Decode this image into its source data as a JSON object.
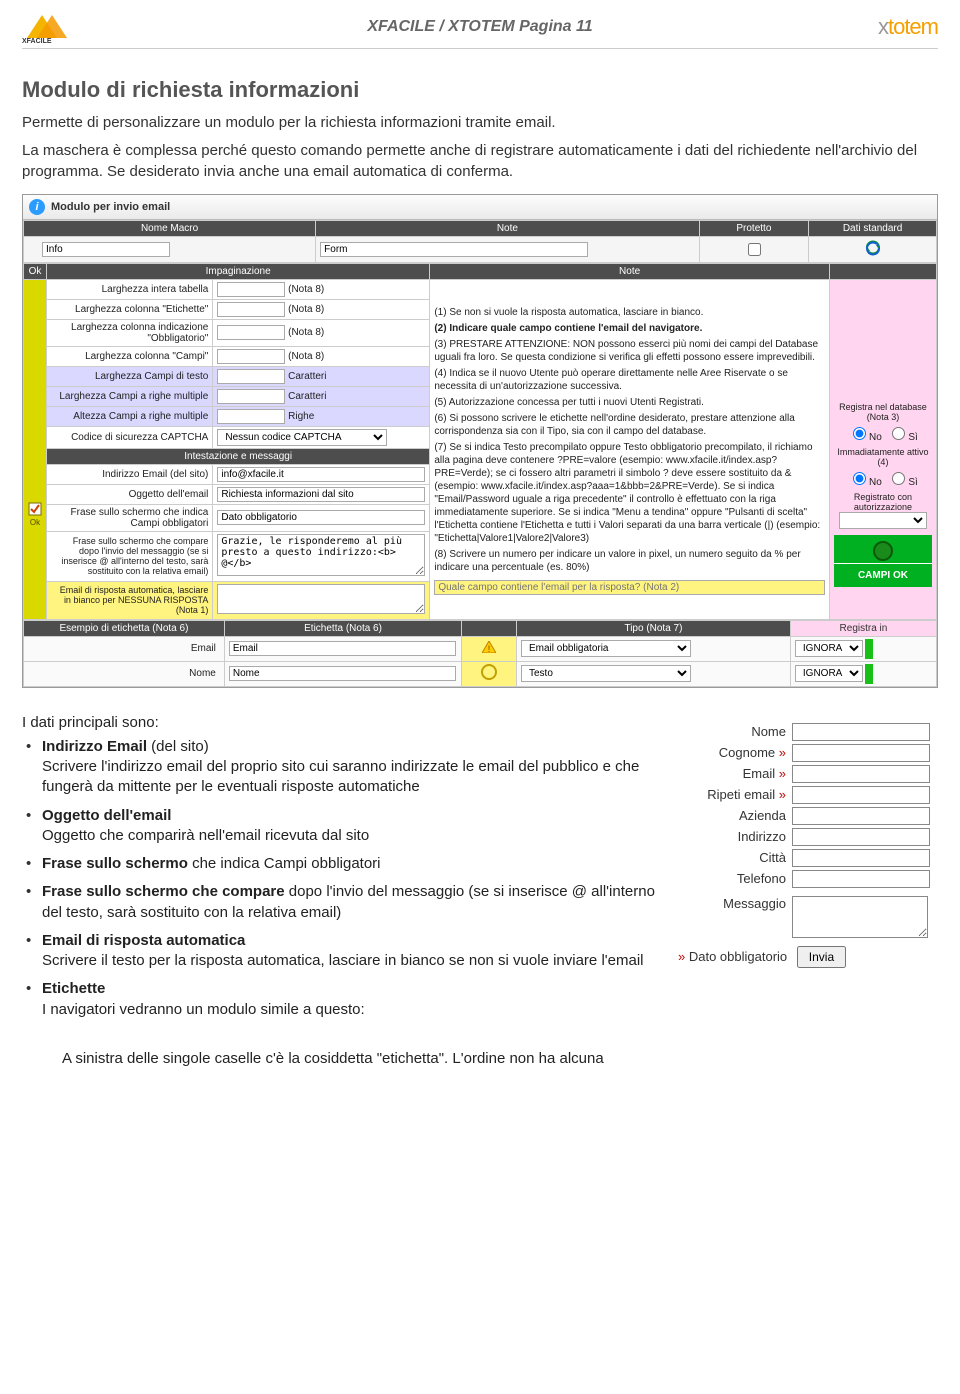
{
  "header": {
    "title": "XFACILE / XTOTEM Pagina 11",
    "brand_left": "xfacile",
    "brand_right": "xtotem"
  },
  "section": {
    "heading": "Modulo di richiesta informazioni",
    "intro1": "Permette di personalizzare un modulo per la richiesta informazioni tramite email.",
    "intro2": "La maschera è complessa perché questo comando permette anche di registrare automaticamente i dati del richiedente nell'archivio del programma. Se desiderato invia anche una email automatica di conferma."
  },
  "ui": {
    "titlebar": "Modulo per invio email",
    "head": {
      "c1": "Nome Macro",
      "c2": "Note",
      "c3": "Protetto",
      "c4": "Dati standard"
    },
    "macrorow": {
      "name": "Info",
      "note": "Form"
    },
    "sub_head": {
      "ok": "Ok",
      "imp": "Impaginazione",
      "note": "Note"
    },
    "rows": [
      {
        "label": "Larghezza intera tabella",
        "val": "(Nota 8)"
      },
      {
        "label": "Larghezza colonna \"Etichette\"",
        "val": "(Nota 8)"
      },
      {
        "label": "Larghezza colonna indicazione \"Obbligatorio\"",
        "val": "(Nota 8)"
      },
      {
        "label": "Larghezza colonna \"Campi\"",
        "val": "(Nota 8)"
      },
      {
        "label": "Larghezza Campi di testo",
        "val": "Caratteri",
        "hl": true
      },
      {
        "label": "Larghezza Campi a righe multiple",
        "val": "Caratteri",
        "hl": true
      },
      {
        "label": "Altezza Campi a righe multiple",
        "val": "Righe",
        "hl": true
      },
      {
        "label": "Codice di sicurezza CAPTCHA",
        "val": "Nessun codice CAPTCHA",
        "select": true
      },
      {
        "label": "Intestazione e messaggi",
        "span": true,
        "dark": true
      },
      {
        "label": "Indirizzo Email (del sito)",
        "val": "info@xfacile.it"
      },
      {
        "label": "Oggetto dell'email",
        "val": "Richiesta informazioni dal sito"
      },
      {
        "label": "Frase sullo schermo che indica Campi obbligatori",
        "val": "Dato obbligatorio"
      },
      {
        "label": "Frase sullo schermo che compare dopo l'invio del messaggio (se si inserisce @ all'interno del testo, sarà sostituito con la relativa email)",
        "val": "Grazie, le risponderemo al più presto a questo indirizzo:<b> @</b>"
      },
      {
        "label": "Email di risposta automatica, lasciare in bianco per NESSUNA RISPOSTA (Nota 1)",
        "val": "",
        "yellow": true
      }
    ],
    "notes": [
      "(1) Se non si vuole la risposta automatica, lasciare in bianco.",
      "(2) Indicare quale campo contiene l'email del navigatore.",
      "(3) PRESTARE ATTENZIONE: NON possono esserci più nomi dei campi del Database uguali fra loro. Se questa condizione si verifica gli effetti possono essere imprevedibili.",
      "(4) Indica se il nuovo Utente può operare direttamente nelle Aree Riservate o se necessita di un'autorizzazione successiva.",
      "(5) Autorizzazione concessa per tutti i nuovi Utenti Registrati.",
      "(6) Si possono scrivere le etichette nell'ordine desiderato, prestare attenzione alla corrispondenza sia con il Tipo, sia con il campo del database.",
      "(7) Se si indica Testo precompilato oppure Testo obbligatorio precompilato, il richiamo alla pagina deve contenere ?PRE=valore (esempio: www.xfacile.it/index.asp?PRE=Verde); se ci fossero altri parametri il simbolo ? deve essere sostituito da & (esempio: www.xfacile.it/index.asp?aaa=1&bbb=2&PRE=Verde). Se si indica \"Email/Password uguale a riga precedente\" il controllo è effettuato con la riga immediatamente superiore. Se si indica \"Menu a tendina\" oppure \"Pulsanti di scelta\" l'Etichetta contiene l'Etichetta e tutti i Valori separati da una barra verticale (|) (esempio: \"Etichetta|Valore1|Valore2|Valore3)",
      "(8) Scrivere un numero per indicare un valore in pixel, un numero seguito da % per indicare una percentuale (es. 80%)"
    ],
    "note2_placeholder": "Quale campo contiene l'email per la risposta? (Nota 2)",
    "pink": {
      "registra_label": "Registra nel database (Nota 3)",
      "no": "No",
      "si": "Sì",
      "imm_label": "Immadiatamente attivo (4)",
      "reg_auth": "Registrato con autorizzazione",
      "campi_ok": "CAMPI OK",
      "registra_in": "Registra in",
      "ignora": "IGNORA"
    },
    "fields_head": {
      "esempio": "Esempio di etichetta (Nota 6)",
      "et": "Etichetta (Nota 6)",
      "tipo": "Tipo (Nota 7)"
    },
    "fields": [
      {
        "name": "Email",
        "et": "Email",
        "tipo": "Email obbligatoria",
        "warn": true
      },
      {
        "name": "Nome",
        "et": "Nome",
        "tipo": "Testo",
        "warn": false
      }
    ]
  },
  "bullets": {
    "lead": "I dati principali sono:",
    "items": [
      {
        "title": "Indirizzo Email",
        "title_suffix": " (del sito)",
        "body": "Scrivere l'indirizzo email del proprio sito cui saranno indirizzate le email del pubblico e che fungerà da mittente per le eventuali risposte automatiche"
      },
      {
        "title": "Oggetto dell'email",
        "body": "Oggetto che comparirà nell'email ricevuta dal sito"
      },
      {
        "title": "Frase sullo schermo",
        "title_suffix": " che indica Campi obbligatori",
        "body": ""
      },
      {
        "title": "Frase sullo schermo che compare",
        "title_suffix": " dopo l'invio del messaggio (se si inserisce @ all'interno del testo, sarà sostituito con la relativa email)",
        "body": ""
      },
      {
        "title": "Email di risposta automatica",
        "body": "Scrivere il testo per la risposta automatica, lasciare in bianco se non si vuole inviare l'email"
      },
      {
        "title": "Etichette",
        "body": "I navigatori vedranno un modulo simile a questo:"
      }
    ]
  },
  "form_preview": {
    "rows": [
      {
        "label": "Nome",
        "req": false
      },
      {
        "label": "Cognome",
        "req": true
      },
      {
        "label": "Email",
        "req": true
      },
      {
        "label": "Ripeti email",
        "req": true
      },
      {
        "label": "Azienda",
        "req": false
      },
      {
        "label": "Indirizzo",
        "req": false
      },
      {
        "label": "Città",
        "req": false
      },
      {
        "label": "Telefono",
        "req": false
      }
    ],
    "msg_label": "Messaggio",
    "mandatory_note": "Dato obbligatorio",
    "submit": "Invia"
  },
  "closing": "A sinistra delle singole caselle c'è la cosiddetta \"etichetta\". L'ordine non ha alcuna"
}
